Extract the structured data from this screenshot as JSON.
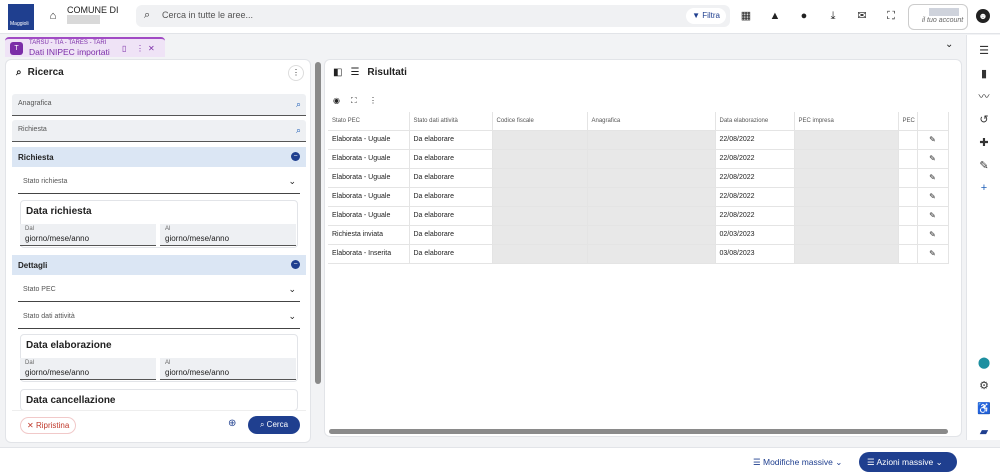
{
  "header": {
    "logo_text": "Maggioli",
    "comune_label": "COMUNE DI",
    "search_placeholder": "Cerca in tutte le aree...",
    "filter_label": "Filtra",
    "account_label": "il tuo account"
  },
  "tab": {
    "subtitle": "TARSU - TIA - TARES - TARI",
    "title": "Dati INIPEC importati"
  },
  "search_panel": {
    "title": "Ricerca",
    "anagrafica": "Anagrafica",
    "richiesta_field": "Richiesta",
    "section_richiesta": "Richiesta",
    "stato_richiesta": "Stato richiesta",
    "data_richiesta": "Data richiesta",
    "dal": "Dal",
    "al": "Al",
    "date_ph": "giorno/mese/anno",
    "section_dettagli": "Dettagli",
    "stato_pec": "Stato PEC",
    "stato_dati": "Stato dati attività",
    "data_elaborazione": "Data elaborazione",
    "data_cancellazione": "Data cancellazione",
    "reset_label": "Ripristina",
    "search_label": "Cerca"
  },
  "results": {
    "title": "Risultati",
    "columns": [
      "Stato PEC",
      "Stato dati attività",
      "Codice fiscale",
      "Anagrafica",
      "Data elaborazione",
      "PEC impresa",
      "PEC"
    ],
    "rows": [
      {
        "stato_pec": "Elaborata - Uguale",
        "stato_dati": "Da elaborare",
        "data": "22/08/2022"
      },
      {
        "stato_pec": "Elaborata - Uguale",
        "stato_dati": "Da elaborare",
        "data": "22/08/2022"
      },
      {
        "stato_pec": "Elaborata - Uguale",
        "stato_dati": "Da elaborare",
        "data": "22/08/2022"
      },
      {
        "stato_pec": "Elaborata - Uguale",
        "stato_dati": "Da elaborare",
        "data": "22/08/2022"
      },
      {
        "stato_pec": "Elaborata - Uguale",
        "stato_dati": "Da elaborare",
        "data": "22/08/2022"
      },
      {
        "stato_pec": "Richiesta inviata",
        "stato_dati": "Da elaborare",
        "data": "02/03/2023"
      },
      {
        "stato_pec": "Elaborata - Inserita",
        "stato_dati": "Da elaborare",
        "data": "03/08/2023"
      }
    ]
  },
  "footer": {
    "modifiche": "Modifiche massive",
    "azioni": "Azioni massive"
  }
}
